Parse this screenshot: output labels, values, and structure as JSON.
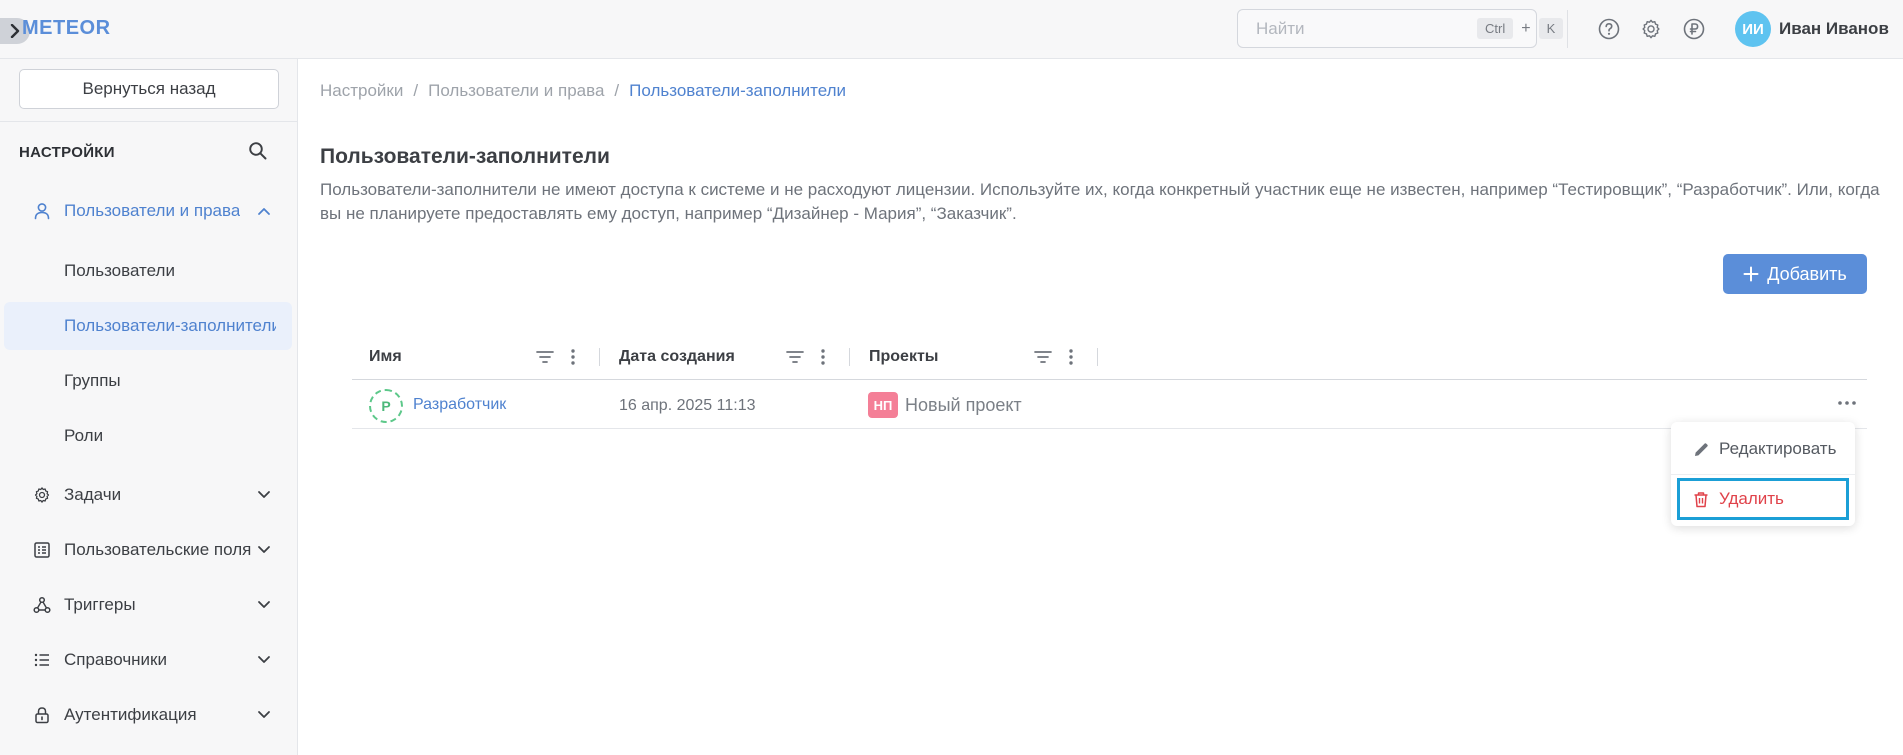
{
  "header": {
    "logo": "METEOR",
    "search_placeholder": "Найти",
    "shortcut_ctrl": "Ctrl",
    "shortcut_plus": "+",
    "shortcut_key": "K",
    "user_initials": "ИИ",
    "user_name": "Иван Иванов",
    "icons": [
      "help-icon",
      "gear-icon",
      "ruble-icon"
    ]
  },
  "sidebar": {
    "back_label": "Вернуться назад",
    "heading": "НАСТРОЙКИ",
    "sections": [
      {
        "label": "Пользователи и права",
        "icon": "user-icon",
        "expanded": true
      },
      {
        "label": "Задачи",
        "icon": "gear-icon",
        "expanded": false
      },
      {
        "label": "Пользовательские поля",
        "icon": "form-icon",
        "expanded": false
      },
      {
        "label": "Триггеры",
        "icon": "nodes-icon",
        "expanded": false
      },
      {
        "label": "Справочники",
        "icon": "list-icon",
        "expanded": false
      },
      {
        "label": "Аутентификация",
        "icon": "lock-icon",
        "expanded": false
      }
    ],
    "subitems": [
      {
        "label": "Пользователи",
        "active": false
      },
      {
        "label": "Пользователи-заполнители",
        "active": true
      },
      {
        "label": "Группы",
        "active": false
      },
      {
        "label": "Роли",
        "active": false
      }
    ]
  },
  "breadcrumb": [
    "Настройки",
    "Пользователи и права",
    "Пользователи-заполнители"
  ],
  "page": {
    "title": "Пользователи-заполнители",
    "description": "Пользователи-заполнители не имеют доступа к системе и не расходуют лицензии. Используйте их, когда конкретный участник еще не известен, например “Тестировщик”, “Разработчик”. Или, когда вы не планируете предоставлять ему доступ, например “Дизайнер - Мария”, “Заказчик”.",
    "add_label": "Добавить"
  },
  "table": {
    "columns": [
      "Имя",
      "Дата создания",
      "Проекты"
    ],
    "rows": [
      {
        "initial": "Р",
        "name": "Разработчик",
        "created": "16 апр. 2025 11:13",
        "project_badge": "НП",
        "project_name": "Новый проект"
      }
    ]
  },
  "context_menu": {
    "items": [
      {
        "label": "Редактировать",
        "icon": "pencil-icon"
      },
      {
        "label": "Удалить",
        "icon": "trash-icon"
      }
    ]
  },
  "colors": {
    "accent": "#5b8ed9",
    "link": "#4f82cf",
    "danger": "#e0424a",
    "highlight": "#1b9fd6",
    "avatar": "#5ec3f0",
    "badge": "#f47f97"
  }
}
